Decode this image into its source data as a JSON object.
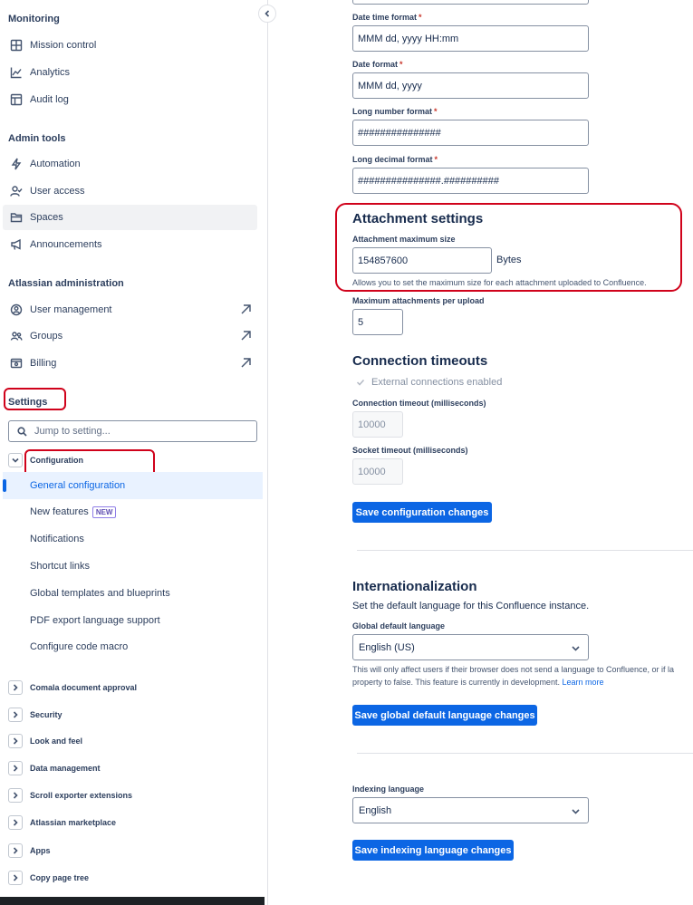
{
  "sidebar": {
    "monitoring": {
      "title": "Monitoring",
      "items": [
        {
          "label": "Mission control",
          "icon": "grid-icon"
        },
        {
          "label": "Analytics",
          "icon": "line-chart-icon"
        },
        {
          "label": "Audit log",
          "icon": "table-icon"
        }
      ]
    },
    "admin_tools": {
      "title": "Admin tools",
      "items": [
        {
          "label": "Automation",
          "icon": "lightning-icon"
        },
        {
          "label": "User access",
          "icon": "user-check-icon"
        },
        {
          "label": "Spaces",
          "icon": "folder-icon"
        },
        {
          "label": "Announcements",
          "icon": "megaphone-icon"
        }
      ]
    },
    "atlassian_admin": {
      "title": "Atlassian administration",
      "items": [
        {
          "label": "User management",
          "icon": "person-circle-icon"
        },
        {
          "label": "Groups",
          "icon": "people-icon"
        },
        {
          "label": "Billing",
          "icon": "billing-icon"
        }
      ]
    },
    "settings": {
      "title": "Settings",
      "search_placeholder": "Jump to setting...",
      "configuration": {
        "label": "Configuration",
        "items": [
          {
            "label": "General configuration"
          },
          {
            "label": "New features",
            "badge": "NEW"
          },
          {
            "label": "Notifications"
          },
          {
            "label": "Shortcut links"
          },
          {
            "label": "Global templates and blueprints"
          },
          {
            "label": "PDF export language support"
          },
          {
            "label": "Configure code macro"
          }
        ]
      },
      "categories": [
        "Comala document approval",
        "Security",
        "Look and feel",
        "Data management",
        "Scroll exporter extensions",
        "Atlassian marketplace",
        "Apps",
        "Copy page tree"
      ]
    }
  },
  "main": {
    "date_time_format": {
      "label": "Date time format",
      "value": "MMM dd, yyyy HH:mm"
    },
    "date_format": {
      "label": "Date format",
      "value": "MMM dd, yyyy"
    },
    "long_number_format": {
      "label": "Long number format",
      "value": "###############"
    },
    "long_decimal_format": {
      "label": "Long decimal format",
      "value": "###############.##########"
    },
    "required_marker": "*",
    "attachment": {
      "title": "Attachment settings",
      "max_size_label": "Attachment maximum size",
      "max_size_value": "154857600",
      "max_size_unit": "Bytes",
      "max_size_help": "Allows you to set the maximum size for each attachment uploaded to Confluence.",
      "max_per_upload_label": "Maximum attachments per upload",
      "max_per_upload_value": "5"
    },
    "connection": {
      "title": "Connection timeouts",
      "external_label": "External connections enabled",
      "conn_timeout_label": "Connection timeout (milliseconds)",
      "conn_timeout_value": "10000",
      "socket_timeout_label": "Socket timeout (milliseconds)",
      "socket_timeout_value": "10000",
      "save_button": "Save configuration changes"
    },
    "i18n": {
      "title": "Internationalization",
      "description": "Set the default language for this Confluence instance.",
      "global_label": "Global default language",
      "global_value": "English (US)",
      "help_line1": "This will only affect users if their browser does not send a language to Confluence, or if la",
      "help_line2": "property to false. This feature is currently in development.",
      "learn_more": "Learn more",
      "save_button": "Save global default language changes"
    },
    "indexing": {
      "label": "Indexing language",
      "value": "English",
      "save_button": "Save indexing language changes"
    }
  }
}
